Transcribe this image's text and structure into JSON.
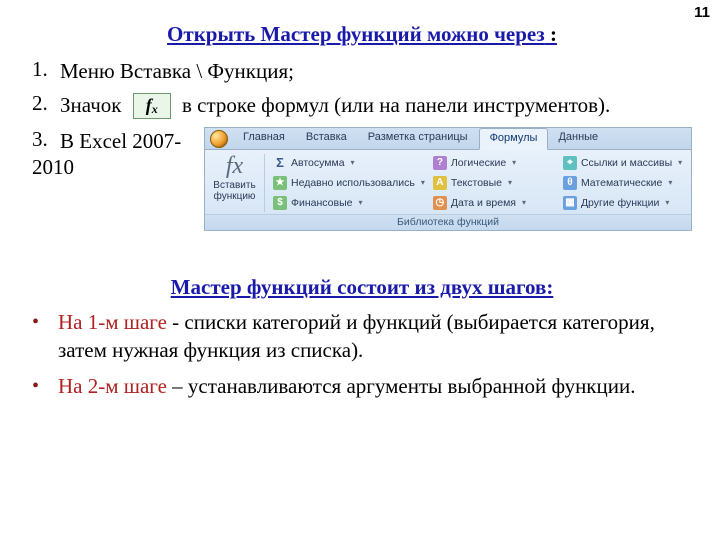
{
  "page_number": "11",
  "heading1_text": "Открыть Мастер функций можно через",
  "heading1_colon": " :",
  "list": {
    "n1": "1.",
    "t1": "Меню Вставка \\ Функция;",
    "n2": "2.",
    "t2a": "Значок",
    "fx_chip_f": "f",
    "fx_chip_x": "x",
    "t2b": "в строке формул (или на панели инструментов).",
    "n3": "3.",
    "t3": "В Excel 2007-",
    "t3b": "2010"
  },
  "ribbon": {
    "tabs": {
      "home": "Главная",
      "insert": "Вставка",
      "layout": "Разметка страницы",
      "formulas": "Формулы",
      "data": "Данные"
    },
    "insert_fn_fx": "fx",
    "insert_fn_label": "Вставить функцию",
    "buttons": {
      "autosum_sym": "Σ",
      "autosum": "Автосумма",
      "recent": "Недавно использовались",
      "financial": "Финансовые",
      "logical": "Логические",
      "text": "Текстовые",
      "datetime": "Дата и время",
      "lookup": "Ссылки и массивы",
      "math": "Математические",
      "more": "Другие функции"
    },
    "caption": "Библиотека функций"
  },
  "heading2": "Мастер функций состоит из двух шагов:",
  "steps": {
    "s1_red": "На 1-м шаге",
    "s1_rest": " - списки категорий и функций (выбирается категория, затем нужная функция из списка).",
    "s2_red": "На 2-м шаге",
    "s2_rest": " – устанавливаются аргументы выбранной функции."
  }
}
